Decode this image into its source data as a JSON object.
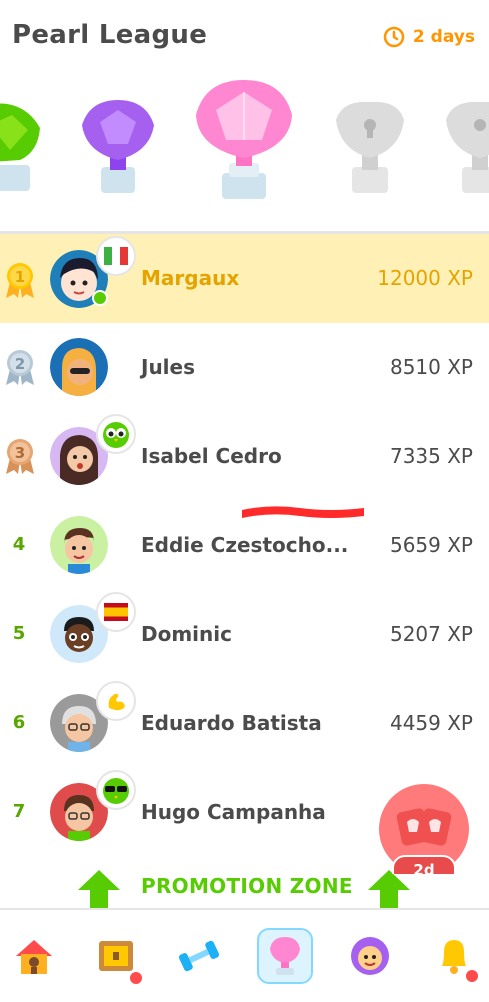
{
  "header": {
    "title": "Pearl League",
    "timer_text": "2 days"
  },
  "leaderboard": [
    {
      "rank": "1",
      "name": "Margaux",
      "xp": "12000 XP",
      "current_user": true,
      "badge": "flag-italy-icon"
    },
    {
      "rank": "2",
      "name": "Jules",
      "xp": "8510 XP",
      "current_user": false,
      "badge": ""
    },
    {
      "rank": "3",
      "name": "Isabel Cedro",
      "xp": "7335 XP",
      "current_user": false,
      "badge": "duo-owl-icon"
    },
    {
      "rank": "4",
      "name": "Eddie Czestocho...",
      "xp": "5659 XP",
      "current_user": false,
      "badge": ""
    },
    {
      "rank": "5",
      "name": "Dominic",
      "xp": "5207 XP",
      "current_user": false,
      "badge": "flag-spain-icon"
    },
    {
      "rank": "6",
      "name": "Eduardo Batista",
      "xp": "4459 XP",
      "current_user": false,
      "badge": "bicep-icon"
    },
    {
      "rank": "7",
      "name": "Hugo Campanha",
      "xp": "",
      "current_user": false,
      "badge": "duo-sunglasses-icon"
    }
  ],
  "promotion": {
    "label": "PROMOTION ZONE"
  },
  "fab": {
    "label": "2d"
  },
  "nav": [
    "home-icon",
    "treasure-chest-icon",
    "dumbbell-icon",
    "league-trophy-icon",
    "profile-icon",
    "bell-icon"
  ],
  "colors": {
    "accent_green": "#58cc02",
    "gold": "#ffc800",
    "highlight": "#fff1b6",
    "timer": "#ff9600",
    "fab": "#ff6b6b"
  }
}
